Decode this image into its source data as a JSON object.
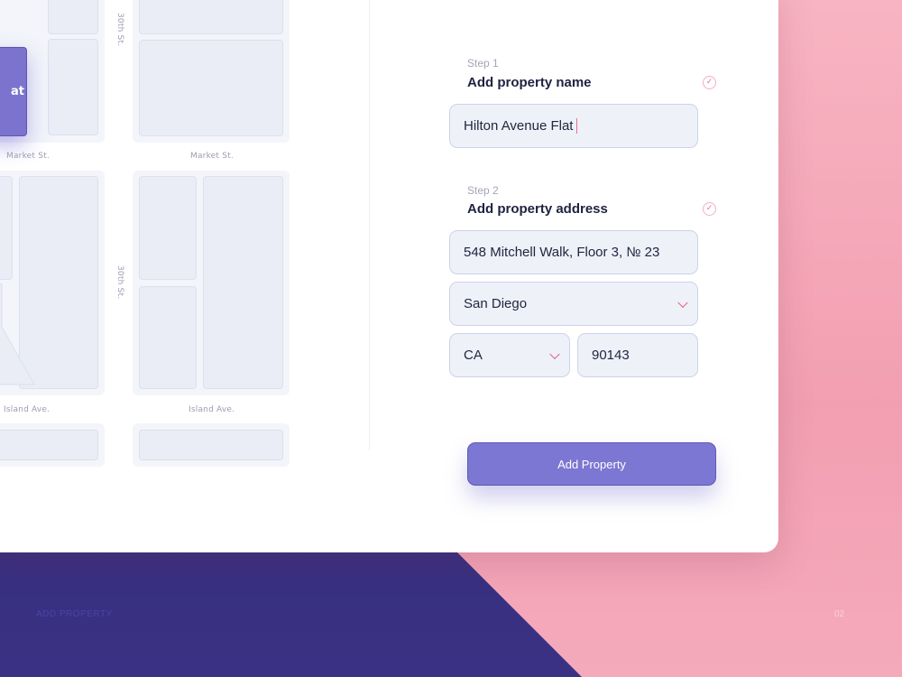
{
  "map": {
    "marker_label": "at",
    "streets": {
      "market_left": "Market St.",
      "market_right": "Market St.",
      "island_left": "Island Ave.",
      "island_right": "Island Ave.",
      "thirtieth_top": "30th St.",
      "thirtieth_mid": "30th St."
    }
  },
  "form": {
    "step1": {
      "label": "Step 1",
      "title": "Add property name",
      "value": "Hilton Avenue Flat"
    },
    "step2": {
      "label": "Step 2",
      "title": "Add property address",
      "address": "548 Mitchell Walk, Floor 3, № 23",
      "city": "San Diego",
      "state": "CA",
      "zip": "90143"
    },
    "submit_label": "Add Property"
  },
  "footer": {
    "title": "ADD PROPERTY",
    "page": "02"
  },
  "colors": {
    "accent": "#7c77d2",
    "pink": "#f29fb1",
    "navy": "#2d2a6e",
    "check": "#ea6f8b"
  }
}
